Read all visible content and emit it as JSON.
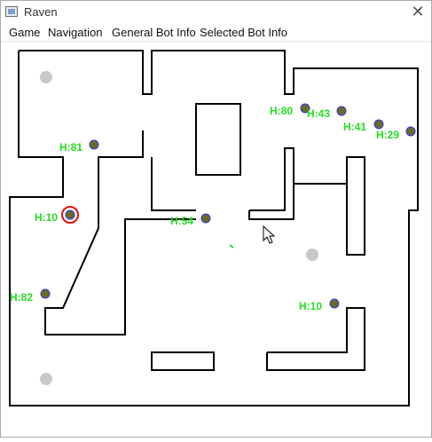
{
  "window": {
    "title": "Raven",
    "close_symbol": "✕"
  },
  "menu": [
    {
      "label": "Game"
    },
    {
      "label": "Navigation"
    },
    {
      "label": "General Bot Info"
    },
    {
      "label": "Selected Bot Info"
    }
  ],
  "colors": {
    "health_label": "#22dd22",
    "wall": "#000000",
    "spawn_point": "#c8c8c8",
    "selected_ring": "#e01010",
    "bot_body": "#6b6b20"
  },
  "bots": [
    {
      "health": "H:80",
      "selected": false
    },
    {
      "health": "H:43",
      "selected": false
    },
    {
      "health": "H:41",
      "selected": false
    },
    {
      "health": "H:29",
      "selected": false
    },
    {
      "health": "H:81",
      "selected": false
    },
    {
      "health": "H:10",
      "selected": true
    },
    {
      "health": "H:54",
      "selected": false
    },
    {
      "health": "H:82",
      "selected": false
    },
    {
      "health": "H:10",
      "selected": false
    }
  ],
  "spawn_points": 4,
  "cursor_icon": "mouse-pointer-icon"
}
